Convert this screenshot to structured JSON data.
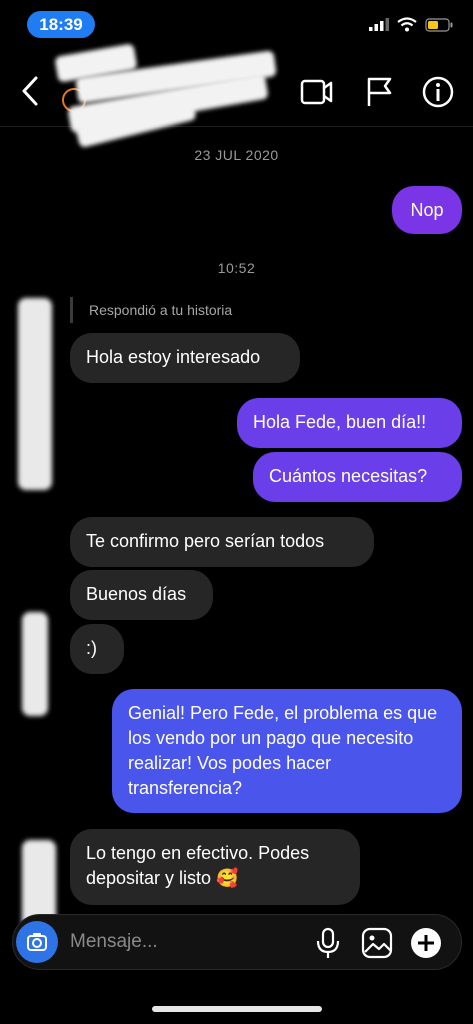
{
  "status_bar": {
    "time": "18:39"
  },
  "header": {
    "contact_name": ""
  },
  "thread": {
    "date_divider": "23 JUL 2020",
    "time_divider": "10:52",
    "reply_note": "Respondió a tu historia",
    "messages": [
      {
        "from": "me",
        "text": "Nop"
      },
      {
        "from": "them",
        "text": "Hola estoy interesado"
      },
      {
        "from": "me",
        "text": "Hola Fede, buen día!!"
      },
      {
        "from": "me",
        "text": "Cuántos necesitas?"
      },
      {
        "from": "them",
        "text": "Te confirmo pero serían todos"
      },
      {
        "from": "them",
        "text": "Buenos días"
      },
      {
        "from": "them",
        "text": ":)"
      },
      {
        "from": "me",
        "text": "Genial! Pero Fede, el problema es que los vendo por un pago que necesito realizar! Vos podes hacer transferencia?"
      },
      {
        "from": "them",
        "text": "Lo tengo en efectivo. Podes depositar y listo 🥰"
      }
    ]
  },
  "composer": {
    "placeholder": "Mensaje..."
  },
  "colors": {
    "accent": "#1f7cf2",
    "bubble_in": "#262626",
    "bubble_out_purple": "#7a35e6",
    "bubble_out_blue": "#4a55ec"
  }
}
